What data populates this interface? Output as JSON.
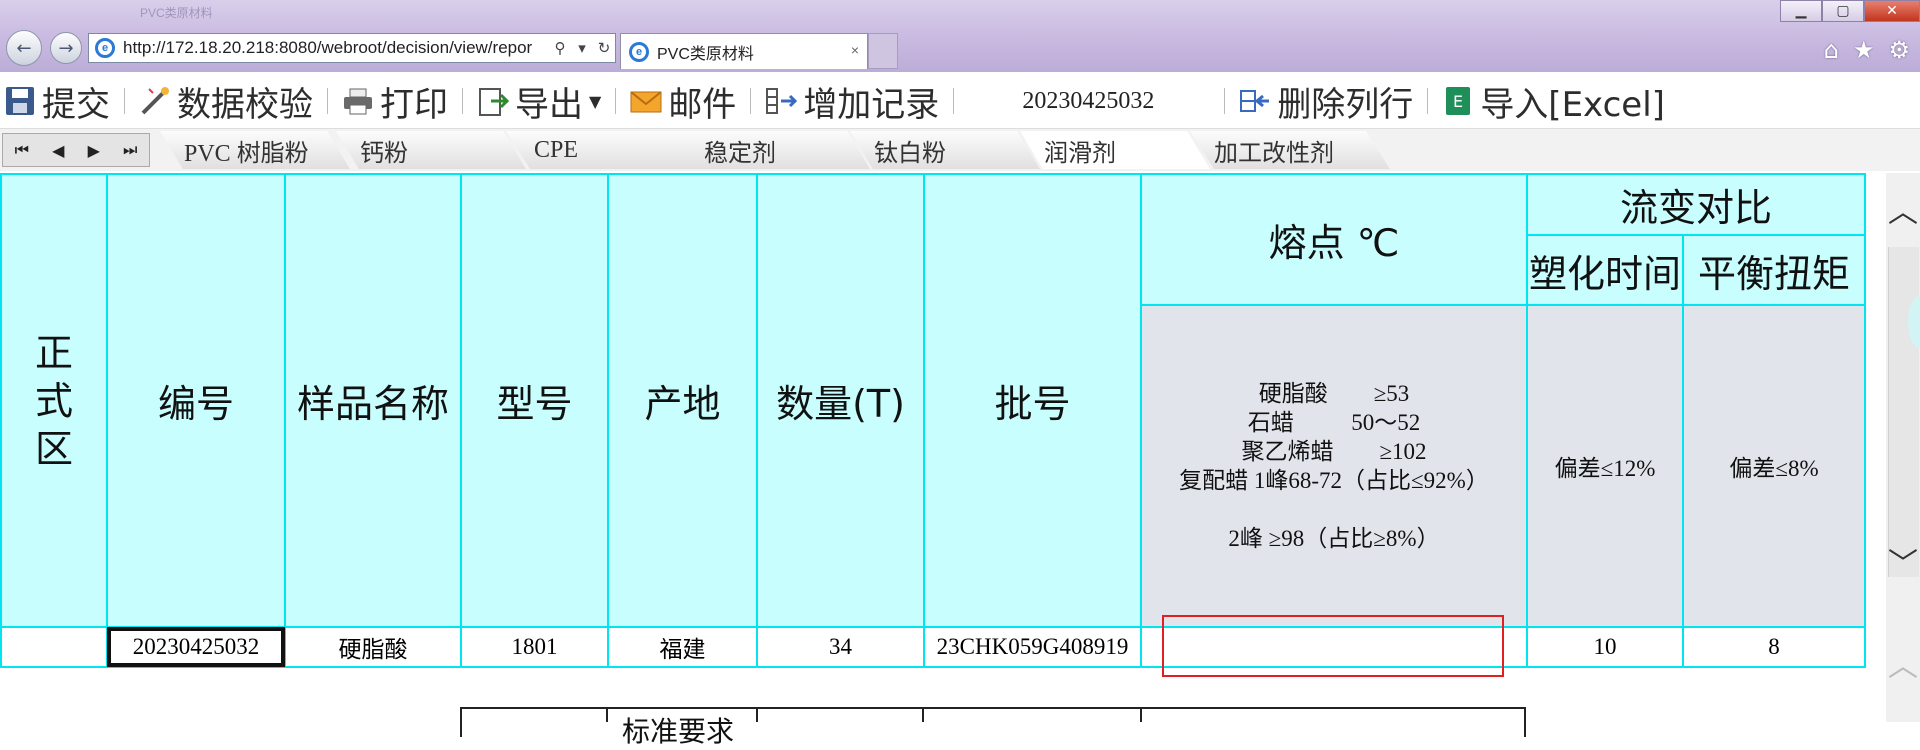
{
  "browser": {
    "address": "http://172.18.20.218:8080/webroot/decision/view/repor",
    "tab_title": "PVC类原材料",
    "title_strip": "PVC类原材料",
    "tab_close": "×",
    "back_icon": "arrow-left-icon",
    "forward_icon": "arrow-right-icon",
    "home_icon": "home-icon",
    "favorites_icon": "star-icon",
    "settings_icon": "gear-icon"
  },
  "window_controls": {
    "minimize": "▁",
    "maximize": "▢",
    "close": "✕"
  },
  "toolbar": {
    "submit": "提交",
    "validate": "数据校验",
    "print": "打印",
    "export": "导出",
    "email": "邮件",
    "add_record": "增加记录",
    "record_number": "20230425032",
    "delete_row": "删除列行",
    "import_excel": "导入[Excel]"
  },
  "sheet_nav": [
    "⏮",
    "◀",
    "▶",
    "⏭"
  ],
  "sheets": [
    "PVC 树脂粉",
    "钙粉",
    "CPE",
    "稳定剂",
    "钛白粉",
    "润滑剂",
    "加工改性剂"
  ],
  "active_sheet": "润滑剂",
  "table": {
    "headers": {
      "formal_area": "正式区",
      "number": "编号",
      "sample_name": "样品名称",
      "model": "型号",
      "origin": "产地",
      "quantity": "数量(T)",
      "batch": "批号",
      "melting_point": "熔点 ℃",
      "rheology": "流变对比",
      "plasticizing_time": "塑化时间",
      "balance_torque": "平衡扭矩"
    },
    "criteria": {
      "melting_point": "硬脂酸        ≥53\n石蜡          50～52\n聚乙烯蜡        ≥102\n复配蜡 1峰68-72（占比≤92%）\n\n2峰 ≥98（占比≥8%）",
      "plasticizing_time": "偏差≤12%",
      "balance_torque": "偏差≤8%"
    },
    "rows": [
      {
        "formal_area": "",
        "number": "20230425032",
        "sample_name": "硬脂酸",
        "model": "1801",
        "origin": "福建",
        "quantity": "34",
        "batch": "23CHK059G408919",
        "melting_point": "",
        "plasticizing_time": "10",
        "balance_torque": "8"
      }
    ]
  },
  "lower_table": {
    "partial_header": "标准要求"
  },
  "scrollbar": {
    "up": "︿",
    "down": "﹀",
    "extra_up": "︿"
  },
  "colors": {
    "header_bg": "#c8fefe",
    "criteria_bg": "#e2e4ec",
    "grid": "#00e5ef",
    "highlight": "#e02020"
  }
}
